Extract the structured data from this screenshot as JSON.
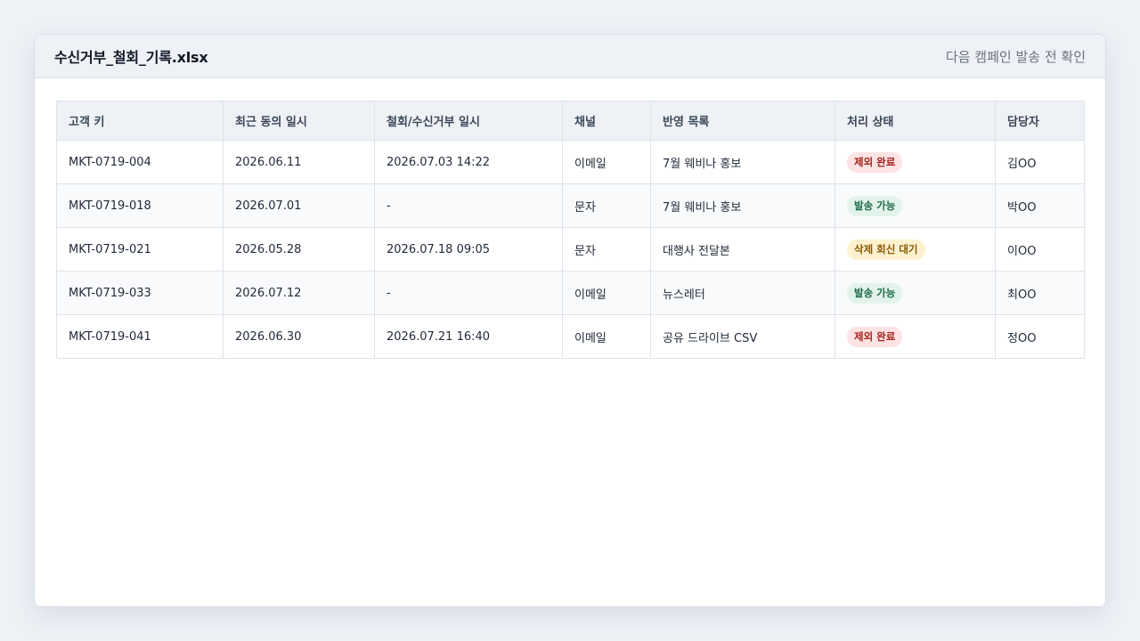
{
  "window": {
    "file_name": "수신거부_철회_기록.xlsx",
    "subtitle": "다음 캠페인 발송 전 확인"
  },
  "table": {
    "headers": [
      "고객 키",
      "최근 동의 일시",
      "철회/수신거부 일시",
      "채널",
      "반영 목록",
      "처리 상태",
      "담당자"
    ],
    "rows": [
      {
        "key": "MKT-0719-004",
        "consent": "2026.06.11",
        "withdraw": "2026.07.03 14:22",
        "channel": "이메일",
        "list": "7월 웨비나 홍보",
        "status": "제외 완료",
        "status_type": "red",
        "owner": "김OO"
      },
      {
        "key": "MKT-0719-018",
        "consent": "2026.07.01",
        "withdraw": "-",
        "channel": "문자",
        "list": "7월 웨비나 홍보",
        "status": "발송 가능",
        "status_type": "green",
        "owner": "박OO"
      },
      {
        "key": "MKT-0719-021",
        "consent": "2026.05.28",
        "withdraw": "2026.07.18 09:05",
        "channel": "문자",
        "list": "대행사 전달본",
        "status": "삭제 회신 대기",
        "status_type": "yellow",
        "owner": "이OO"
      },
      {
        "key": "MKT-0719-033",
        "consent": "2026.07.12",
        "withdraw": "-",
        "channel": "이메일",
        "list": "뉴스레터",
        "status": "발송 가능",
        "status_type": "green",
        "owner": "최OO"
      },
      {
        "key": "MKT-0719-041",
        "consent": "2026.06.30",
        "withdraw": "2026.07.21 16:40",
        "channel": "이메일",
        "list": "공유 드라이브 CSV",
        "status": "제외 완료",
        "status_type": "red",
        "owner": "정OO"
      }
    ]
  },
  "colors": {
    "status_red_bg": "#fde3e3",
    "status_green_bg": "#e3f3ec",
    "status_yellow_bg": "#fdf1cf"
  }
}
